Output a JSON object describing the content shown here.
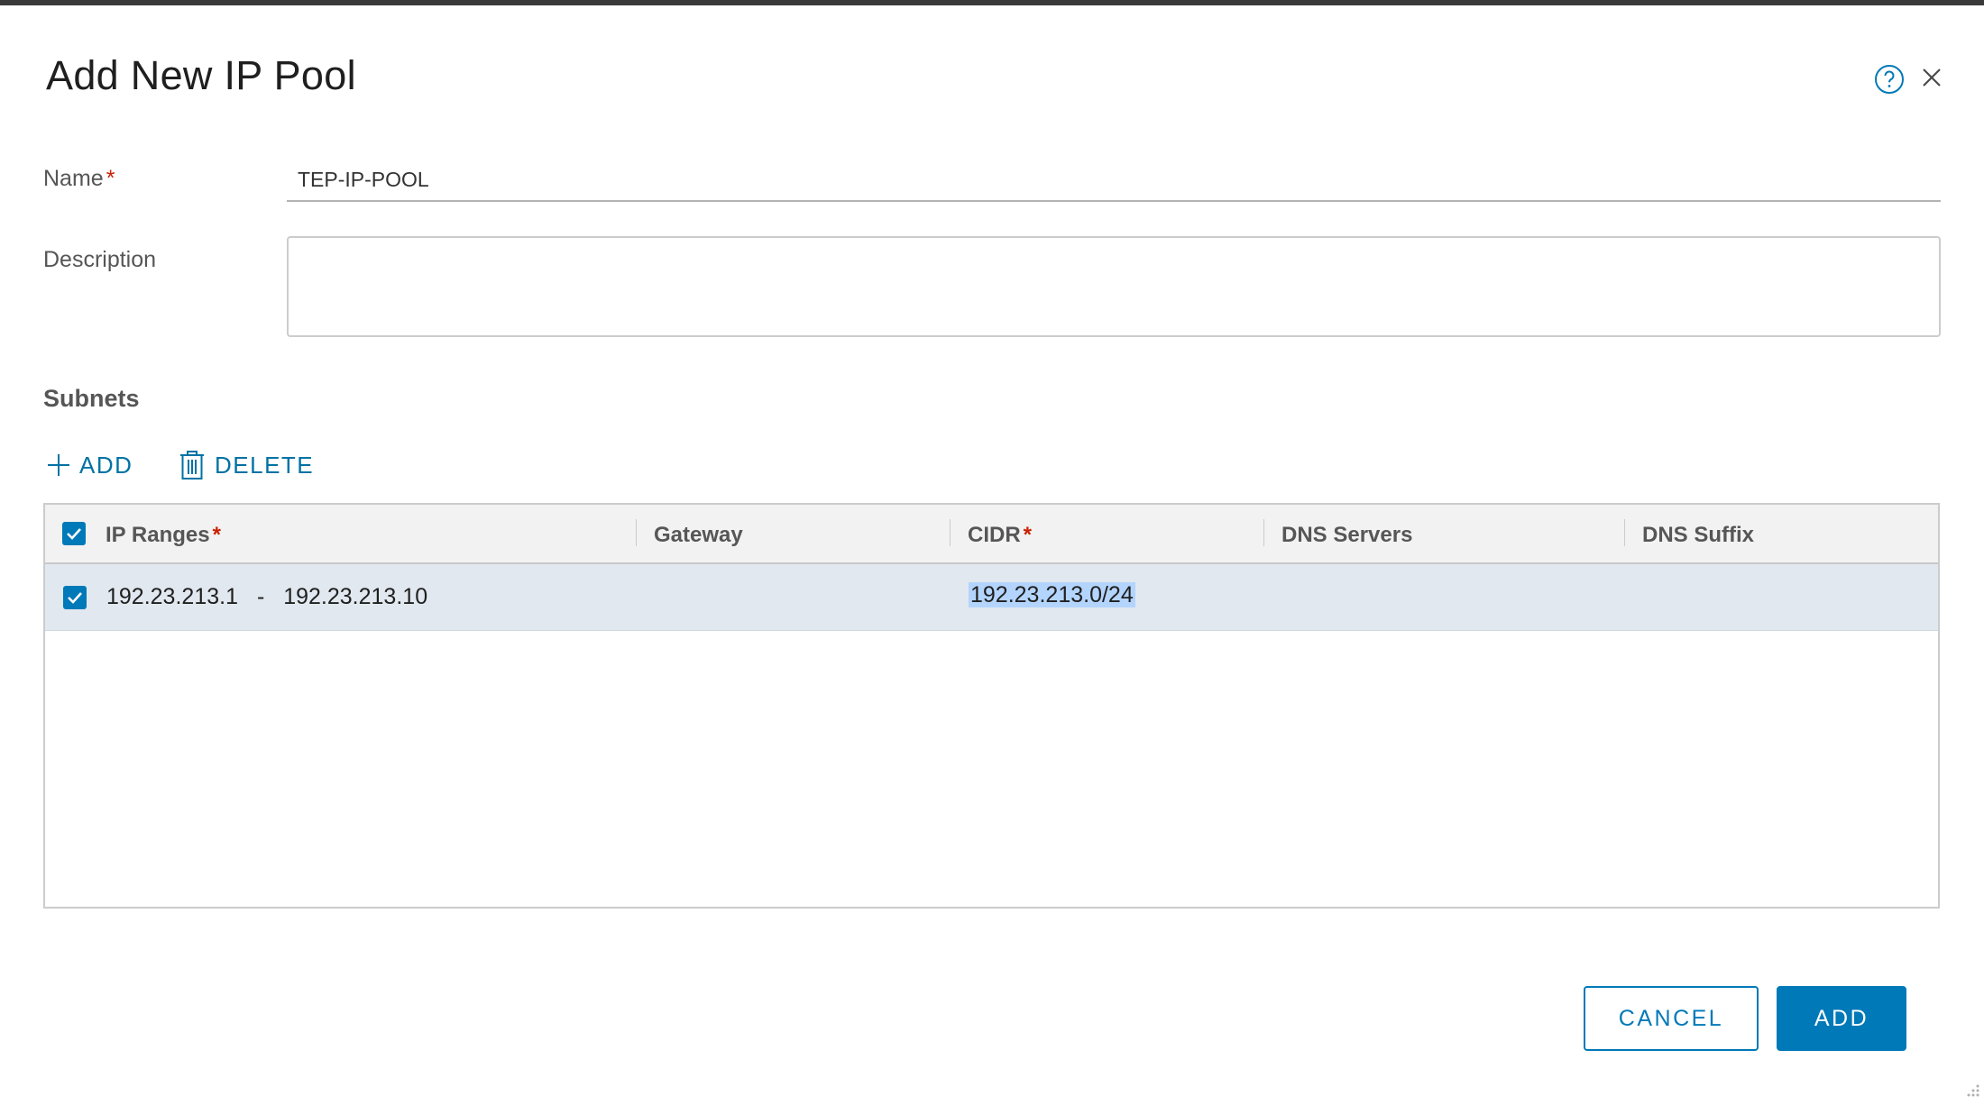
{
  "dialog": {
    "title": "Add New IP Pool"
  },
  "form": {
    "name_label": "Name",
    "name_required": "*",
    "name_value": "TEP-IP-POOL",
    "description_label": "Description",
    "description_value": ""
  },
  "subnets": {
    "section_title": "Subnets",
    "add_label": "ADD",
    "delete_label": "DELETE",
    "columns": [
      {
        "label": "IP Ranges",
        "required": "*"
      },
      {
        "label": "Gateway",
        "required": ""
      },
      {
        "label": "CIDR",
        "required": "*"
      },
      {
        "label": "DNS Servers",
        "required": ""
      },
      {
        "label": "DNS Suffix",
        "required": ""
      }
    ],
    "rows": [
      {
        "selected": true,
        "ip_range_start": "192.23.213.1",
        "ip_range_separator": "-",
        "ip_range_end": "192.23.213.10",
        "gateway": "",
        "cidr": "192.23.213.0/24",
        "dns_servers": "",
        "dns_suffix": ""
      }
    ]
  },
  "footer": {
    "cancel_label": "CANCEL",
    "add_label": "ADD"
  },
  "icons": {
    "help": "help-icon",
    "close": "close-icon",
    "plus": "plus-icon",
    "trash": "trash-icon",
    "check": "check-icon"
  },
  "colors": {
    "accent": "#0079b8",
    "link": "#0072a3",
    "required": "#c92100",
    "row_selected": "#e1e8ef"
  }
}
